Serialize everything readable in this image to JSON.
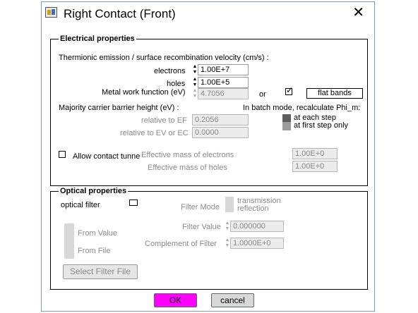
{
  "window": {
    "title": "Right Contact (Front)",
    "app_icon": "app-icon",
    "close_glyph": "✕"
  },
  "electrical": {
    "legend": "Electrical properties",
    "thermionic_label": "Thermionic emission / surface recombination velocity (cm/s) :",
    "electrons_label": "electrons",
    "electrons_value": "1.00E+7",
    "holes_label": "holes",
    "holes_value": "1.00E+5",
    "work_function_label": "Metal work function (eV)",
    "work_function_value": "4.7056",
    "or_label": "or",
    "flat_bands_label": "flat bands",
    "flat_bands_checked": true,
    "barrier_label": "Majority carrier barrier height (eV) :",
    "batch_label": "In batch mode, recalculate Phi_m:",
    "rel_ef_label": "relative to EF",
    "rel_ef_value": "0.2056",
    "rel_ev_label": "relative to EV or EC",
    "rel_ev_value": "0.0000",
    "at_each_step_label": "at each step",
    "at_first_step_label": "at first step only",
    "tunnel_label": "Allow contact tunne",
    "eff_mass_e_label": "Effective mass of electrons",
    "eff_mass_e_value": "1.00E+0",
    "eff_mass_h_label": "Effective mass of holes",
    "eff_mass_h_value": "1.00E+0"
  },
  "optical": {
    "legend": "Optical properties",
    "filter_label": "optical filter",
    "filter_mode_label": "Filter Mode",
    "transmission_label": "transmission",
    "reflection_label": "reflection",
    "from_value_label": "From Value",
    "from_file_label": "From File",
    "filter_value_label": "Filter Value",
    "filter_value": "0.000000",
    "complement_label": "Complement of Filter",
    "complement_value": "1.0000E+0",
    "select_file_label": "Select Filter File"
  },
  "buttons": {
    "ok": "OK",
    "cancel": "cancel",
    "ok_color": "#ff00ff"
  }
}
